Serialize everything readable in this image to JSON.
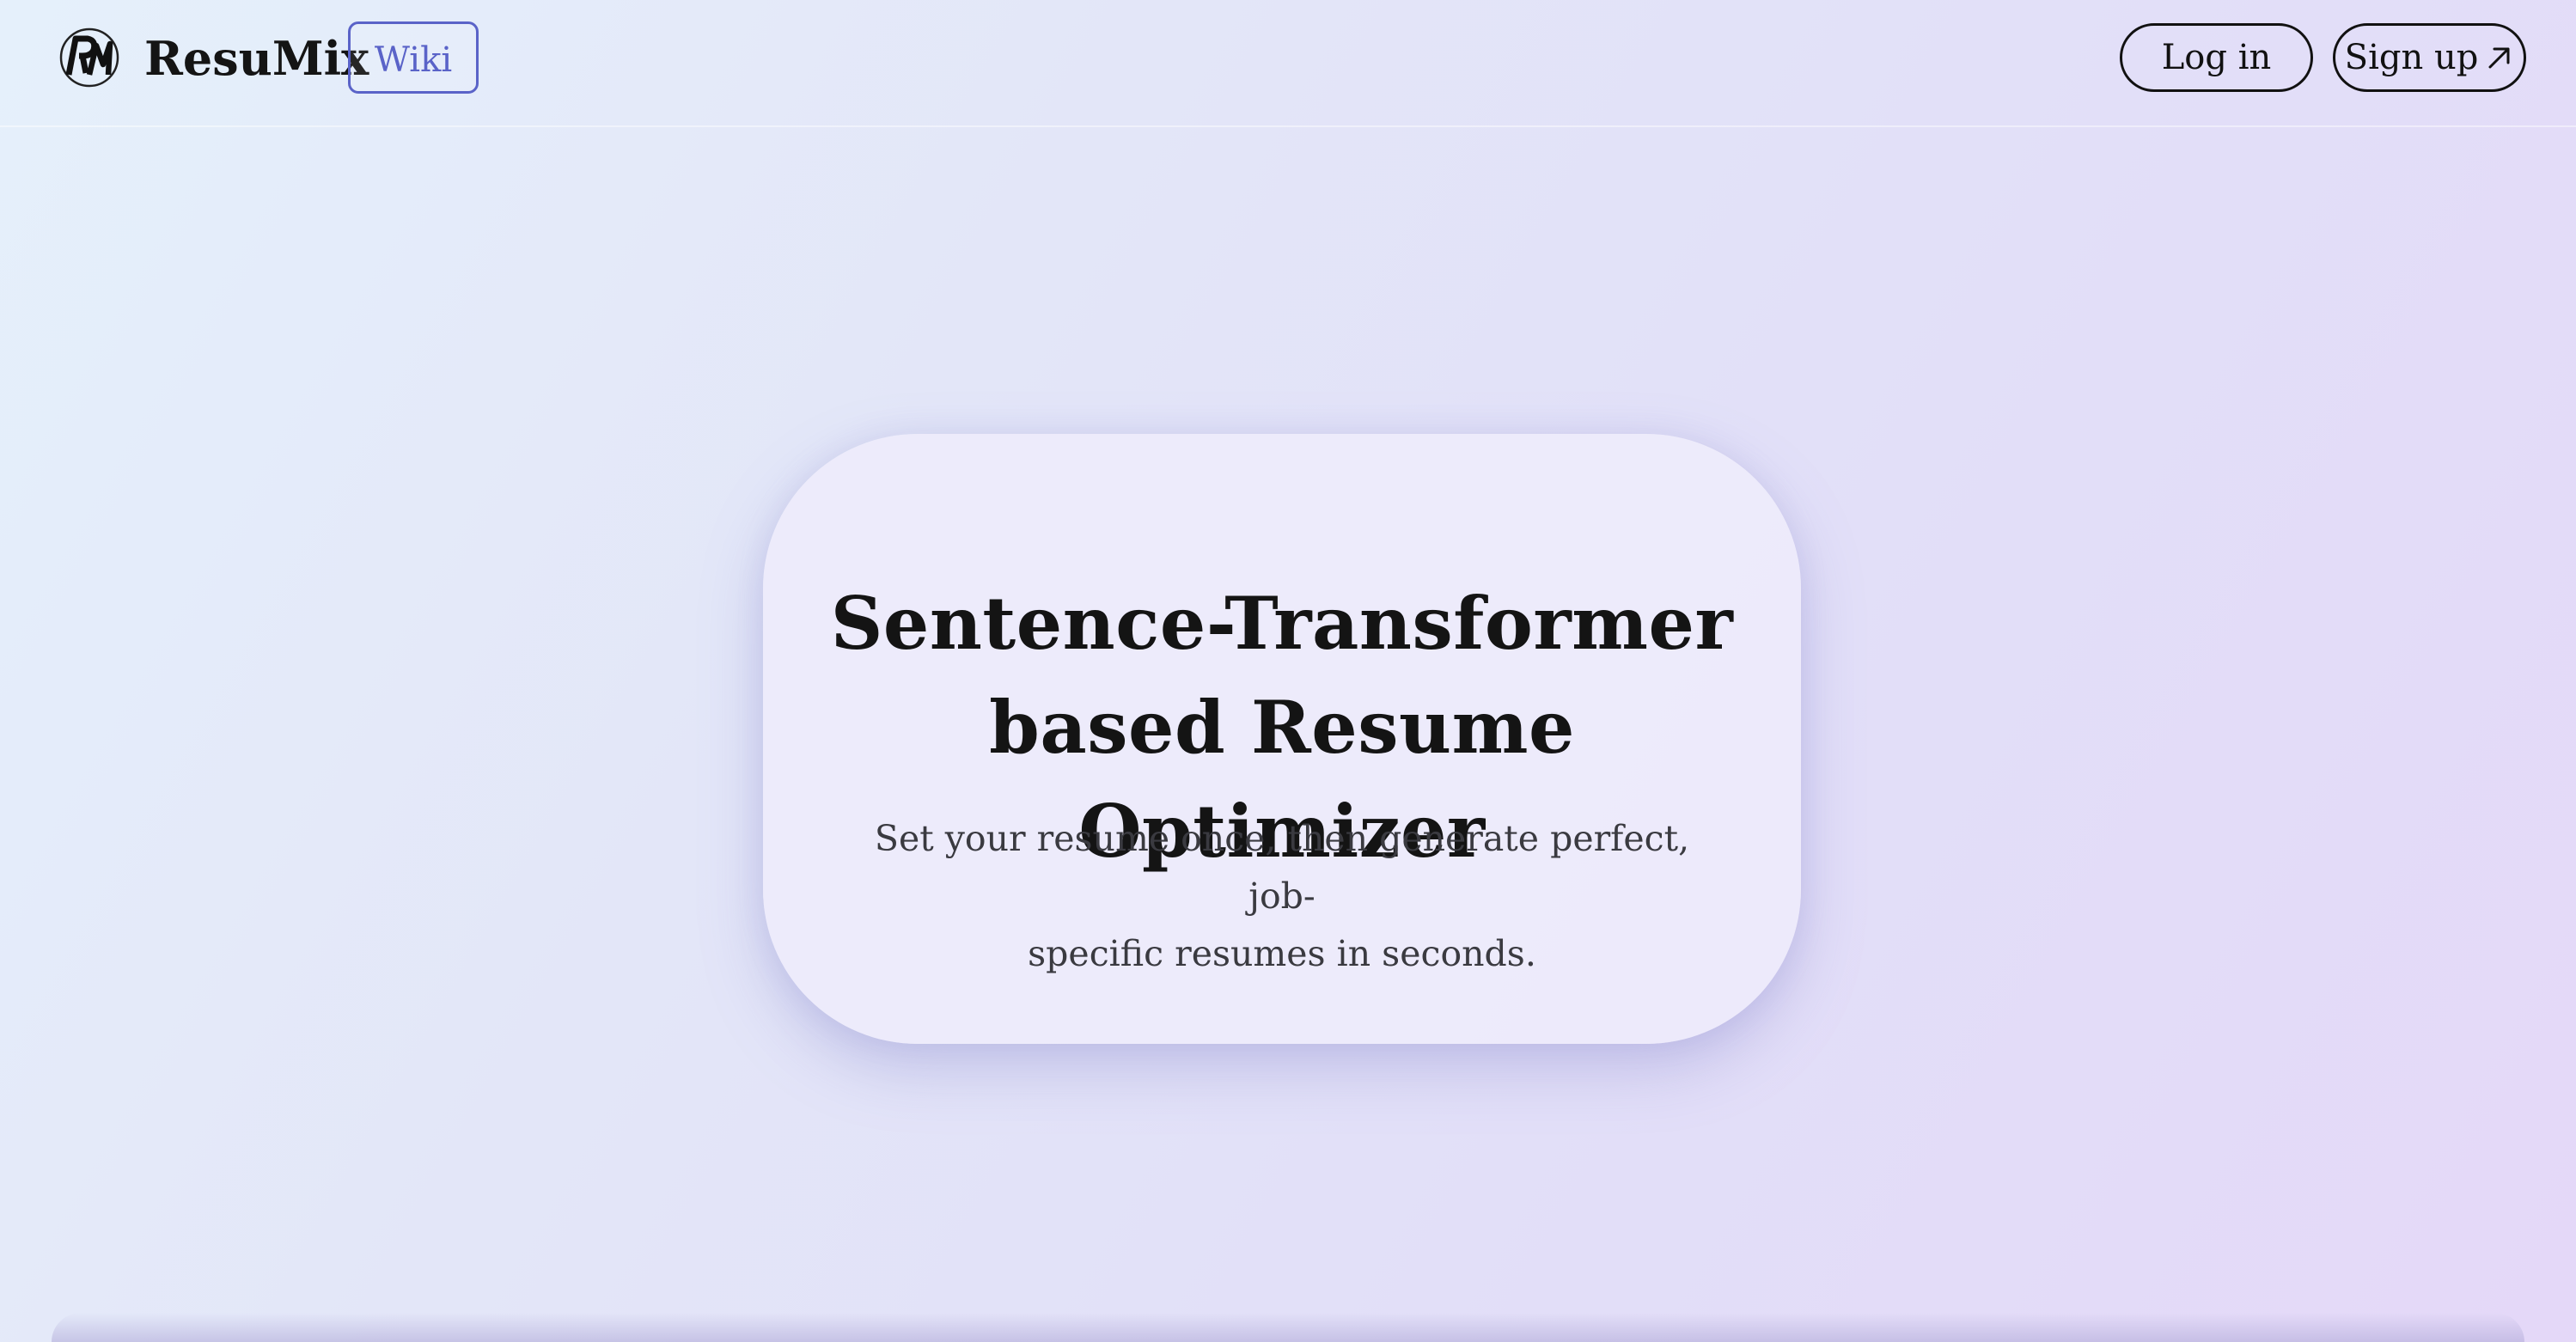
{
  "header": {
    "brand": "ResuMix",
    "logo_icon": "rm-monogram-icon",
    "wiki_label": "Wiki",
    "login_label": "Log in",
    "signup_label": "Sign up",
    "signup_icon": "arrow-up-right-icon"
  },
  "hero": {
    "title_line1": "Sentence-Transformer",
    "title_line2": "based Resume Optimizer",
    "subtitle_line1": "Set your resume once, then generate perfect, job-",
    "subtitle_line2": "specific resumes in seconds."
  },
  "colors": {
    "accent": "#5a63c8",
    "text": "#141414",
    "subtitle": "#3a3a40"
  }
}
